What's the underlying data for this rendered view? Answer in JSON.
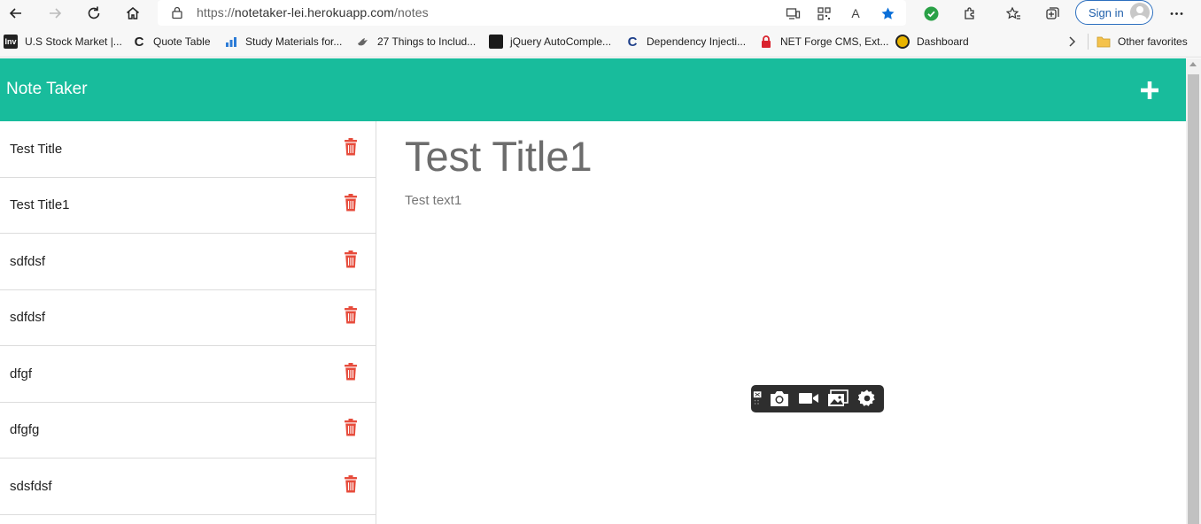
{
  "browser": {
    "url_scheme": "https://",
    "url_host": "notetaker-lei.herokuapp.com",
    "url_path": "/notes",
    "signin_label": "Sign in",
    "read_aloud_glyph": "A",
    "bookmarks": [
      {
        "label": "U.S Stock Market |...",
        "favicon": "Inv"
      },
      {
        "label": "Quote Table",
        "favicon": "C"
      },
      {
        "label": "Study Materials for...",
        "favicon": "chart-icon"
      },
      {
        "label": "27 Things to Includ...",
        "favicon": "dove-icon"
      },
      {
        "label": "jQuery AutoComple...",
        "favicon": "dark-square-icon"
      },
      {
        "label": "Dependency Injecti...",
        "favicon": "C"
      },
      {
        "label": "NET Forge CMS, Ext...",
        "favicon": "lock-red-icon"
      },
      {
        "label": "Dashboard",
        "favicon": "yellow-circle-icon"
      }
    ],
    "other_favorites": "Other favorites"
  },
  "app": {
    "title": "Note Taker",
    "notes": [
      {
        "title": "Test Title"
      },
      {
        "title": "Test Title1"
      },
      {
        "title": "sdfdsf"
      },
      {
        "title": "sdfdsf"
      },
      {
        "title": "dfgf"
      },
      {
        "title": "dfgfg"
      },
      {
        "title": "sdsfdsf"
      }
    ],
    "active_note": {
      "title": "Test Title1",
      "text": "Test text1"
    }
  },
  "colors": {
    "accent": "#18bc9c",
    "trash": "#e74c3c",
    "star": "#0a6fd8",
    "shield": "#2aa147"
  }
}
